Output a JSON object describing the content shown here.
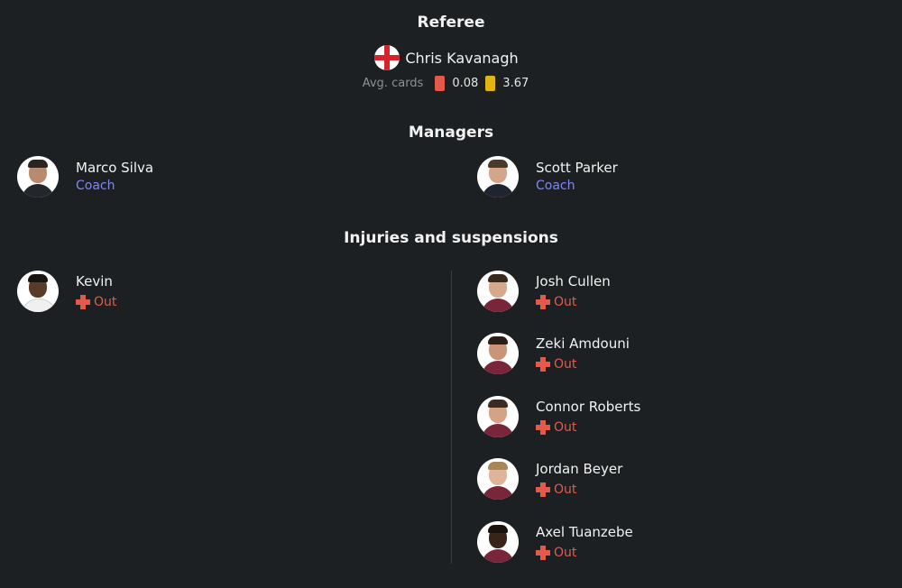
{
  "referee": {
    "title": "Referee",
    "name": "Chris Kavanagh",
    "flag_icon": "england-flag-icon",
    "avg_cards_label": "Avg. cards",
    "red_avg": "0.08",
    "yellow_avg": "3.67"
  },
  "managers": {
    "title": "Managers",
    "home": {
      "name": "Marco Silva",
      "role": "Coach"
    },
    "away": {
      "name": "Scott Parker",
      "role": "Coach"
    }
  },
  "injuries": {
    "title": "Injuries and suspensions",
    "home": [
      {
        "name": "Kevin",
        "status": "Out"
      }
    ],
    "away": [
      {
        "name": "Josh Cullen",
        "status": "Out"
      },
      {
        "name": "Zeki Amdouni",
        "status": "Out"
      },
      {
        "name": "Connor Roberts",
        "status": "Out"
      },
      {
        "name": "Jordan Beyer",
        "status": "Out"
      },
      {
        "name": "Axel Tuanzebe",
        "status": "Out"
      }
    ]
  },
  "colors": {
    "background": "#1d2022",
    "red_card": "#e35a4a",
    "yellow_card": "#e0b512",
    "coach_role": "#7f87f5",
    "out_status": "#e35a4a"
  }
}
